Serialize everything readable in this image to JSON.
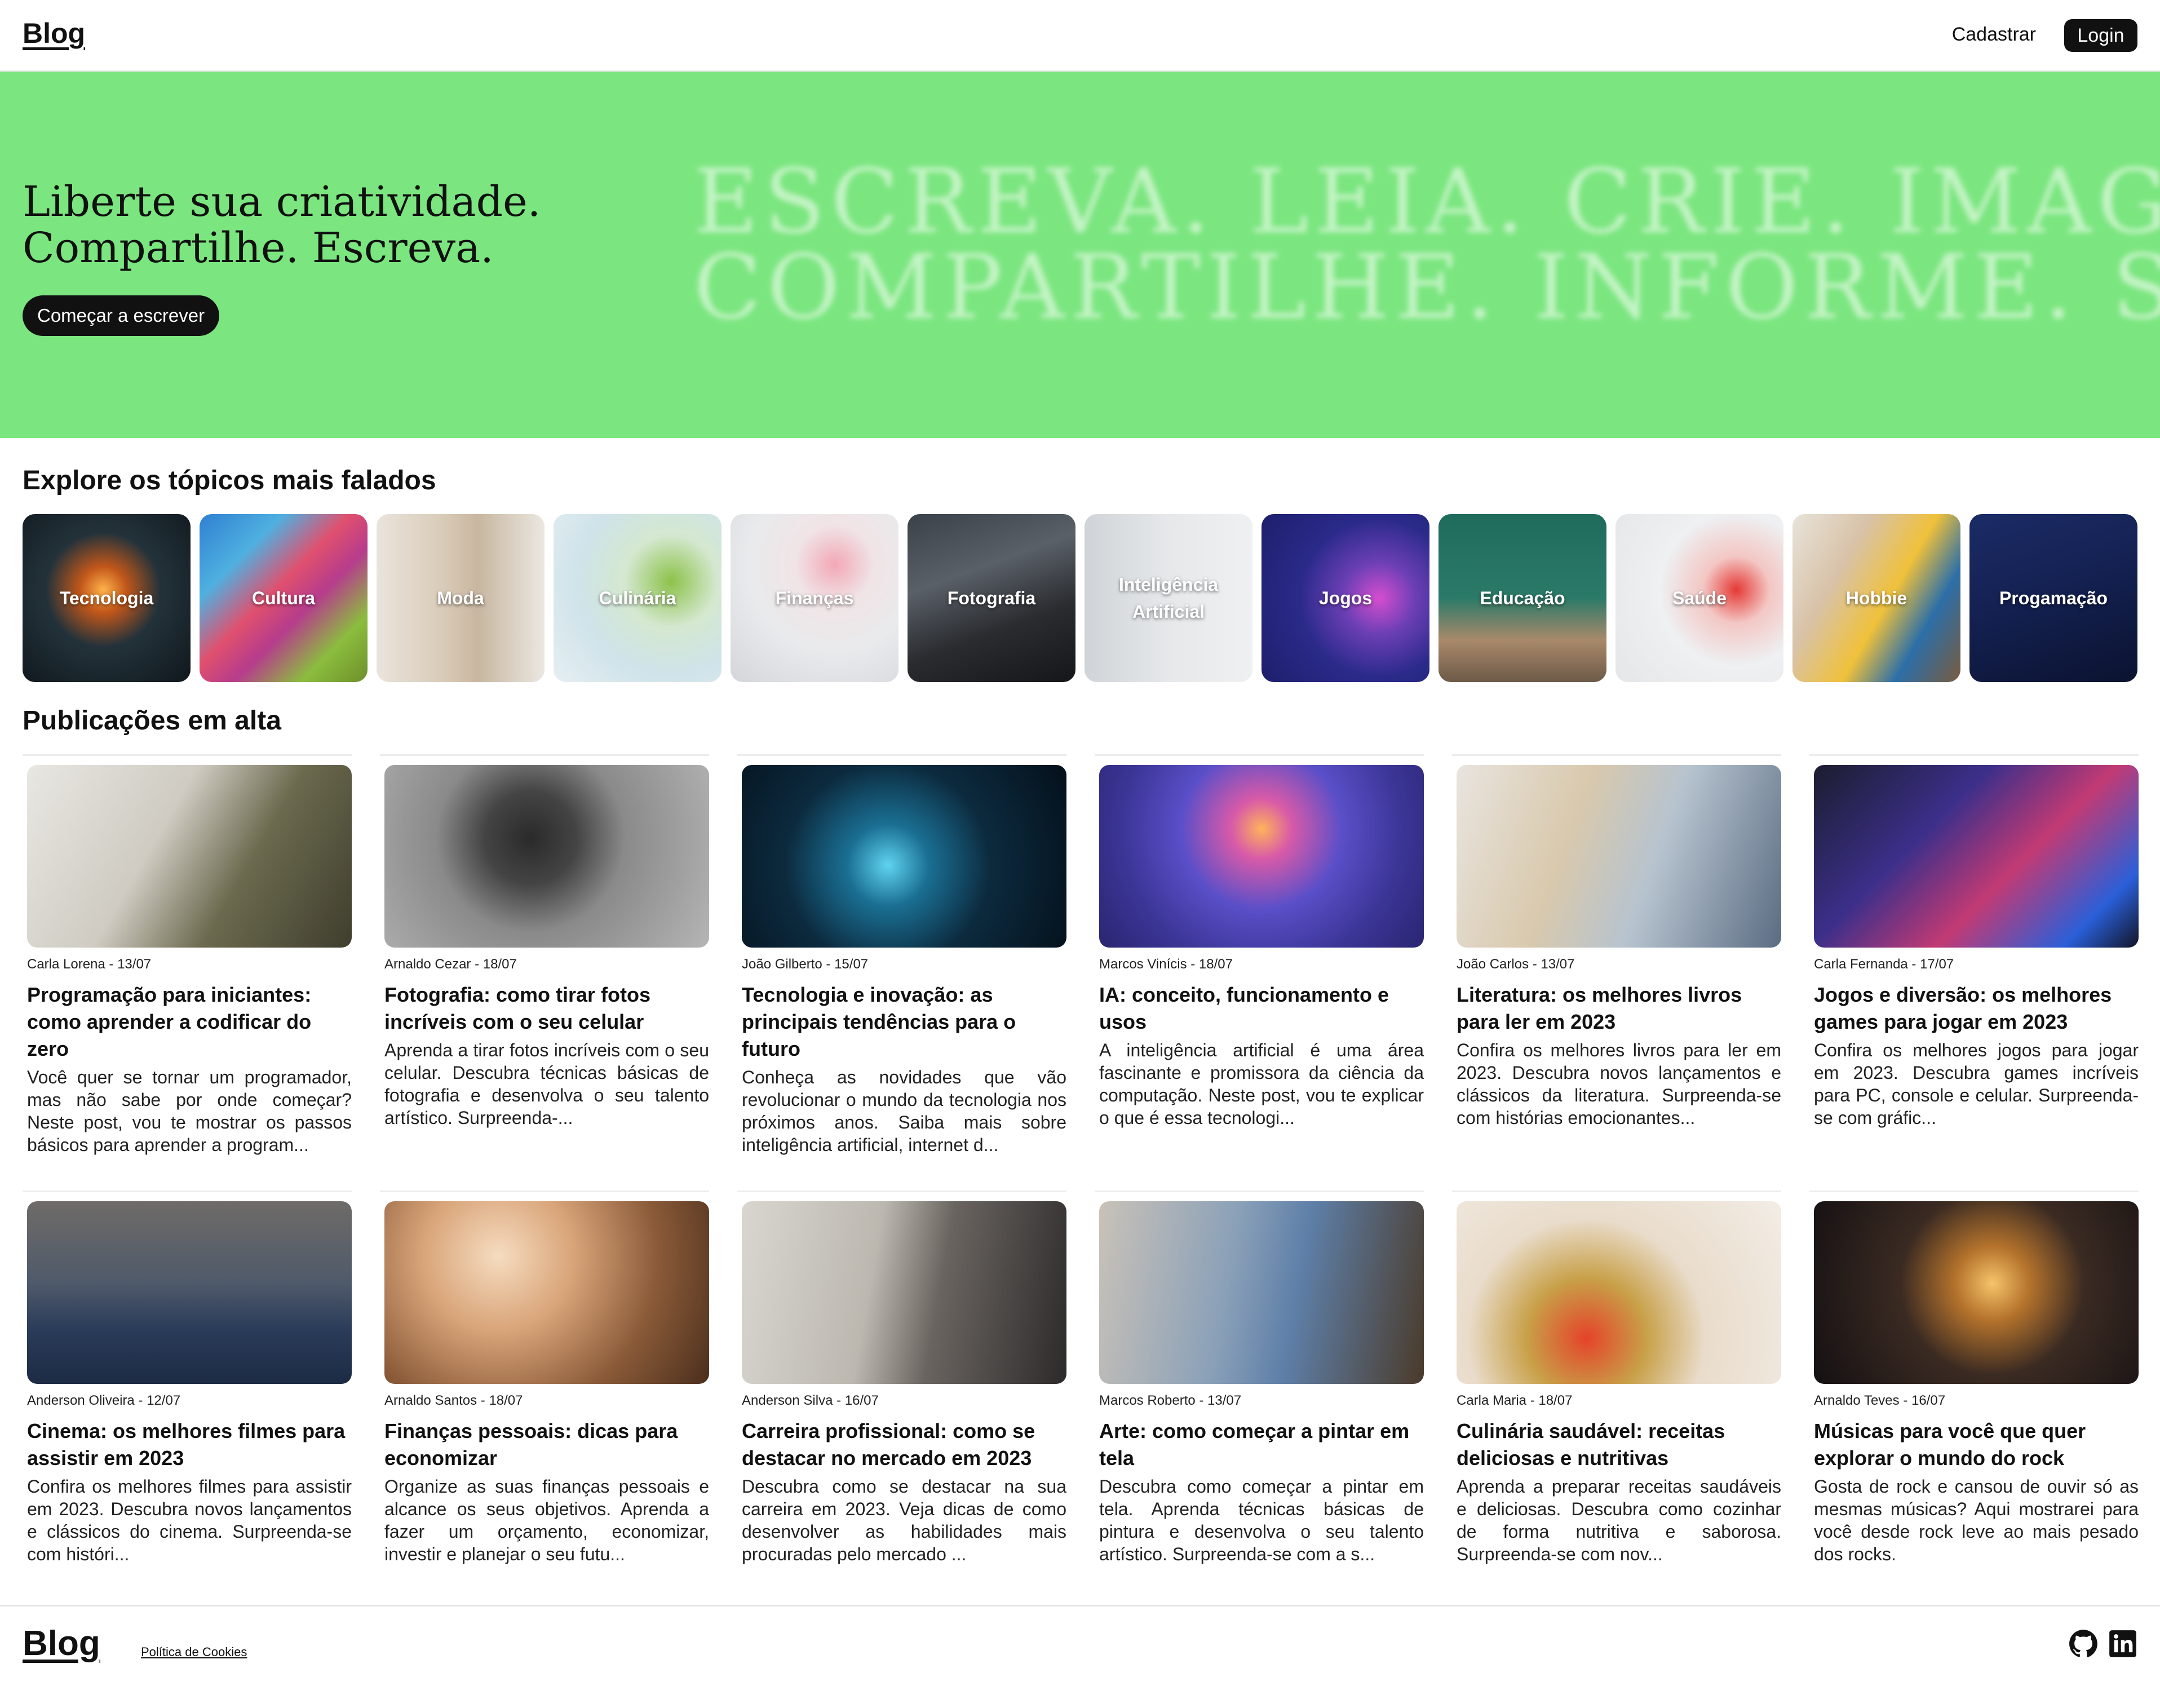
{
  "header": {
    "logo": "Blog",
    "signup": "Cadastrar",
    "login": "Login"
  },
  "hero": {
    "line1": "Liberte sua criatividade.",
    "line2": "Compartilhe. Escreva.",
    "cta": "Começar a escrever",
    "bg_line1": "ESCREVA. LEIA. CRIE. IMAGINE.",
    "bg_line2": "COMPARTILHE. INFORME. SEJA.",
    "color": "#7be67f"
  },
  "topics_title": "Explore os tópicos mais falados",
  "topics": [
    {
      "label": "Tecnologia"
    },
    {
      "label": "Cultura"
    },
    {
      "label": "Moda"
    },
    {
      "label": "Culinária"
    },
    {
      "label": "Finanças"
    },
    {
      "label": "Fotografia"
    },
    {
      "label": "Inteligência Artificial"
    },
    {
      "label": "Jogos"
    },
    {
      "label": "Educação"
    },
    {
      "label": "Saúde"
    },
    {
      "label": "Hobbie"
    },
    {
      "label": "Progamação"
    }
  ],
  "posts_title": "Publicações em alta",
  "posts": [
    {
      "meta": "Carla Lorena - 13/07",
      "title": "Programação para iniciantes: como aprender a codificar do zero",
      "excerpt": "Você quer se tornar um programador, mas não sabe por onde começar? Neste post, vou te mostrar os passos básicos para aprender a program..."
    },
    {
      "meta": "Arnaldo Cezar - 18/07",
      "title": "Fotografia: como tirar fotos incríveis com o seu celular",
      "excerpt": "Aprenda a tirar fotos incríveis com o seu celular. Descubra técnicas básicas de fotografia e desenvolva o seu talento artístico. Surpreenda-..."
    },
    {
      "meta": "João Gilberto - 15/07",
      "title": "Tecnologia e inovação: as principais tendências para o futuro",
      "excerpt": "Conheça as novidades que vão revolucionar o mundo da tecnologia nos próximos anos. Saiba mais sobre inteligência artificial, internet d..."
    },
    {
      "meta": "Marcos Vinícis - 18/07",
      "title": "IA: conceito, funcionamento e usos",
      "excerpt": "A inteligência artificial é uma área fascinante e promissora da ciência da computação. Neste post, vou te explicar o que é essa tecnologi..."
    },
    {
      "meta": "João Carlos - 13/07",
      "title": "Literatura: os melhores livros para ler em 2023",
      "excerpt": "Confira os melhores livros para ler em 2023. Descubra novos lançamentos e clássicos da literatura. Surpreenda-se com histórias emocionantes..."
    },
    {
      "meta": "Carla Fernanda - 17/07",
      "title": "Jogos e diversão: os melhores games para jogar em 2023",
      "excerpt": "Confira os melhores jogos para jogar em 2023. Descubra games incríveis para PC, console e celular. Surpreenda-se com gráfic..."
    },
    {
      "meta": "Anderson Oliveira - 12/07",
      "title": "Cinema: os melhores filmes para assistir em 2023",
      "excerpt": "Confira os melhores filmes para assistir em 2023. Descubra novos lançamentos e clássicos do cinema. Surpreenda-se com históri..."
    },
    {
      "meta": "Arnaldo Santos - 18/07",
      "title": "Finanças pessoais: dicas para economizar",
      "excerpt": "Organize as suas finanças pessoais e alcance os seus objetivos. Aprenda a fazer um orçamento, economizar, investir e planejar o seu futu..."
    },
    {
      "meta": "Anderson Silva - 16/07",
      "title": "Carreira profissional: como se destacar no mercado em 2023",
      "excerpt": "Descubra como se destacar na sua carreira em 2023. Veja dicas de como desenvolver as habilidades mais procuradas pelo mercado ..."
    },
    {
      "meta": "Marcos Roberto - 13/07",
      "title": "Arte: como começar a pintar em tela",
      "excerpt": "Descubra como começar a pintar em tela. Aprenda técnicas básicas de pintura e desenvolva o seu talento artístico. Surpreenda-se com a s..."
    },
    {
      "meta": "Carla Maria - 18/07",
      "title": "Culinária saudável: receitas deliciosas e nutritivas",
      "excerpt": "Aprenda a preparar receitas saudáveis e deliciosas. Descubra como cozinhar de forma nutritiva e saborosa. Surpreenda-se com nov..."
    },
    {
      "meta": "Arnaldo Teves - 16/07",
      "title": "Músicas para você que quer explorar o mundo do rock",
      "excerpt": "Gosta de rock e cansou de ouvir só as mesmas músicas? Aqui mostrarei para você desde rock leve ao mais pesado dos rocks."
    }
  ],
  "footer": {
    "logo": "Blog",
    "cookies": "Política de Cookies",
    "icons": [
      "github-icon",
      "linkedin-icon"
    ]
  }
}
